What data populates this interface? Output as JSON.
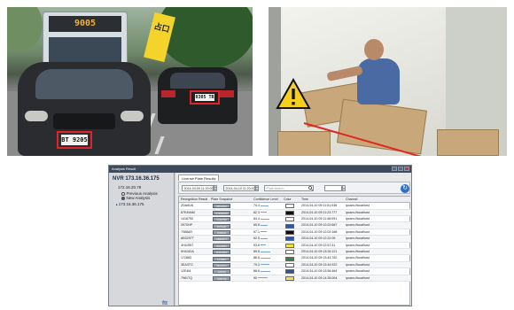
{
  "traffic_photo": {
    "bus_sign": "9005",
    "flag_text": "占口",
    "front_plate": "BT 9205",
    "rear_plate": "0305 TR"
  },
  "warehouse_photo": {
    "warning_icon": "warning-triangle-icon"
  },
  "analysis_window": {
    "title": "Analysis Result",
    "nvr_title": "NVR 173.16.36.175",
    "tree": [
      {
        "label": "172.16.20.79"
      },
      {
        "label": "Previous Analysis",
        "selected": false
      },
      {
        "label": "New Analysis",
        "selected": true
      },
      {
        "label": "173.16.36.175"
      }
    ],
    "corner_logo": "ftt",
    "tab_label": "License Plate Results",
    "toolbar": {
      "start_date": "2014-04-09 11:20:00",
      "end_date": "2014-04-10 11:20:00",
      "search_placeholder": "Plate search",
      "filter_value": "",
      "refresh_icon": "refresh-icon"
    },
    "columns": [
      "Recognition Result",
      "Plate Snapshot",
      "Confidence Level",
      "Color",
      "Time",
      "Channel"
    ],
    "rows": [
      {
        "result": "ZDA6UA",
        "snap": "ZDA6UA",
        "conf": 74.4,
        "color": "#ffffff",
        "time": "2014-04-10 09:11:51:038",
        "channel": "ipcam://localhost"
      },
      {
        "result": "87E49AM",
        "snap": "87E49AM",
        "conf": 62.3,
        "color": "#0f0f0f",
        "time": "2014-04-10 09:11:23:777",
        "channel": "ipcam://localhost"
      },
      {
        "result": "1416790",
        "snap": "1416790",
        "conf": 84.4,
        "color": "#ffffff",
        "time": "2014-04-10 09:11:46:091",
        "channel": "ipcam://localhost"
      },
      {
        "result": "3970HP",
        "snap": "3970HP",
        "conf": 65.6,
        "color": "#2b56a6",
        "time": "2014-04-10 09:12:02:667",
        "channel": "ipcam://localhost"
      },
      {
        "result": "7088AR",
        "snap": "7088AR",
        "conf": 57.1,
        "color": "#0f0f0f",
        "time": "2014-04-10 09:12:02:168",
        "channel": "ipcam://localhost"
      },
      {
        "result": "AB3297T",
        "snap": "AB3297T",
        "conf": 62.5,
        "color": "#2b56a6",
        "time": "2014-04-10 09:12:22:05",
        "channel": "ipcam://localhost"
      },
      {
        "result": "4H4J957",
        "snap": "4H4J957",
        "conf": 53.6,
        "color": "#f2e33a",
        "time": "2014-04-10 09:12:57:41",
        "channel": "ipcam://localhost"
      },
      {
        "result": "9H4J42A",
        "snap": "9H4J42A",
        "conf": 89.5,
        "color": "#ffffff",
        "time": "2014-04-10 09:13:26:121",
        "channel": "ipcam://localhost"
      },
      {
        "result": "172883",
        "snap": "172883",
        "conf": 88.6,
        "color": "#2f8a3c",
        "time": "2014-04-10 09:13:43:762",
        "channel": "ipcam://localhost"
      },
      {
        "result": "3EA3TO",
        "snap": "3EA3TO",
        "conf": 79.3,
        "color": "#ffffff",
        "time": "2014-04-10 09:13:44:922",
        "channel": "ipcam://localhost"
      },
      {
        "result": "12E4M",
        "snap": "12E4M",
        "conf": 88.6,
        "color": "#2b56a6",
        "time": "2014-04-10 09:13:56:464",
        "channel": "ipcam://localhost"
      },
      {
        "result": "7981TQ",
        "snap": "7981TQ",
        "conf": 90,
        "color": "#f2e33a",
        "time": "2014-04-10 09:14:35:004",
        "channel": "ipcam://localhost"
      }
    ]
  }
}
